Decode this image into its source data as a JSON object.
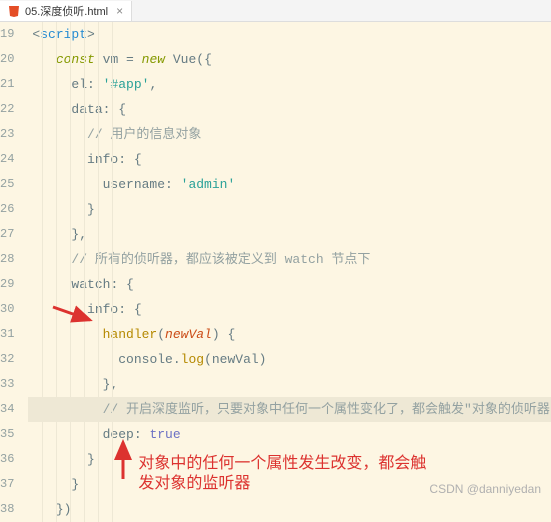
{
  "tab": {
    "label": "05.深度侦听.html"
  },
  "lines": {
    "start": 19,
    "count": 20
  },
  "code": {
    "l19_tag": "script",
    "l20_const": "const",
    "l20_vm": "vm",
    "l20_eq": " = ",
    "l20_new": "new",
    "l20_vue": " Vue",
    "l20_paren": "({",
    "l21_el": "el",
    "l21_c": ": ",
    "l21_v": "'#app'",
    "l21_e": ",",
    "l22_data": "data",
    "l22_c": ": {",
    "l23_com": "// 用户的信息对象",
    "l24_info": "info",
    "l24_c": ": {",
    "l25_user": "username",
    "l25_c": ": ",
    "l25_v": "'admin'",
    "l26": "}",
    "l27": "},",
    "l28_com": "// 所有的侦听器，都应该被定义到 watch 节点下",
    "l29_watch": "watch",
    "l29_c": ": {",
    "l30_info": "info",
    "l30_c": ": {",
    "l31_handler": "handler",
    "l31_p1": "(",
    "l31_param": "newVal",
    "l31_p2": ") {",
    "l32_a": "console.",
    "l32_log": "log",
    "l32_b": "(newVal)",
    "l33": "},",
    "l34_com": "// 开启深度监听，只要对象中任何一个属性变化了，都会触发\"对象的侦听器\"",
    "l35_deep": "deep",
    "l35_c": ": ",
    "l35_v": "true",
    "l36": "}",
    "l37": "}",
    "l38": "})"
  },
  "annotation": {
    "text1": "对象中的任何一个属性发生改变，都会触",
    "text2": "发对象的监听器"
  },
  "watermark": "CSDN @danniyedan"
}
